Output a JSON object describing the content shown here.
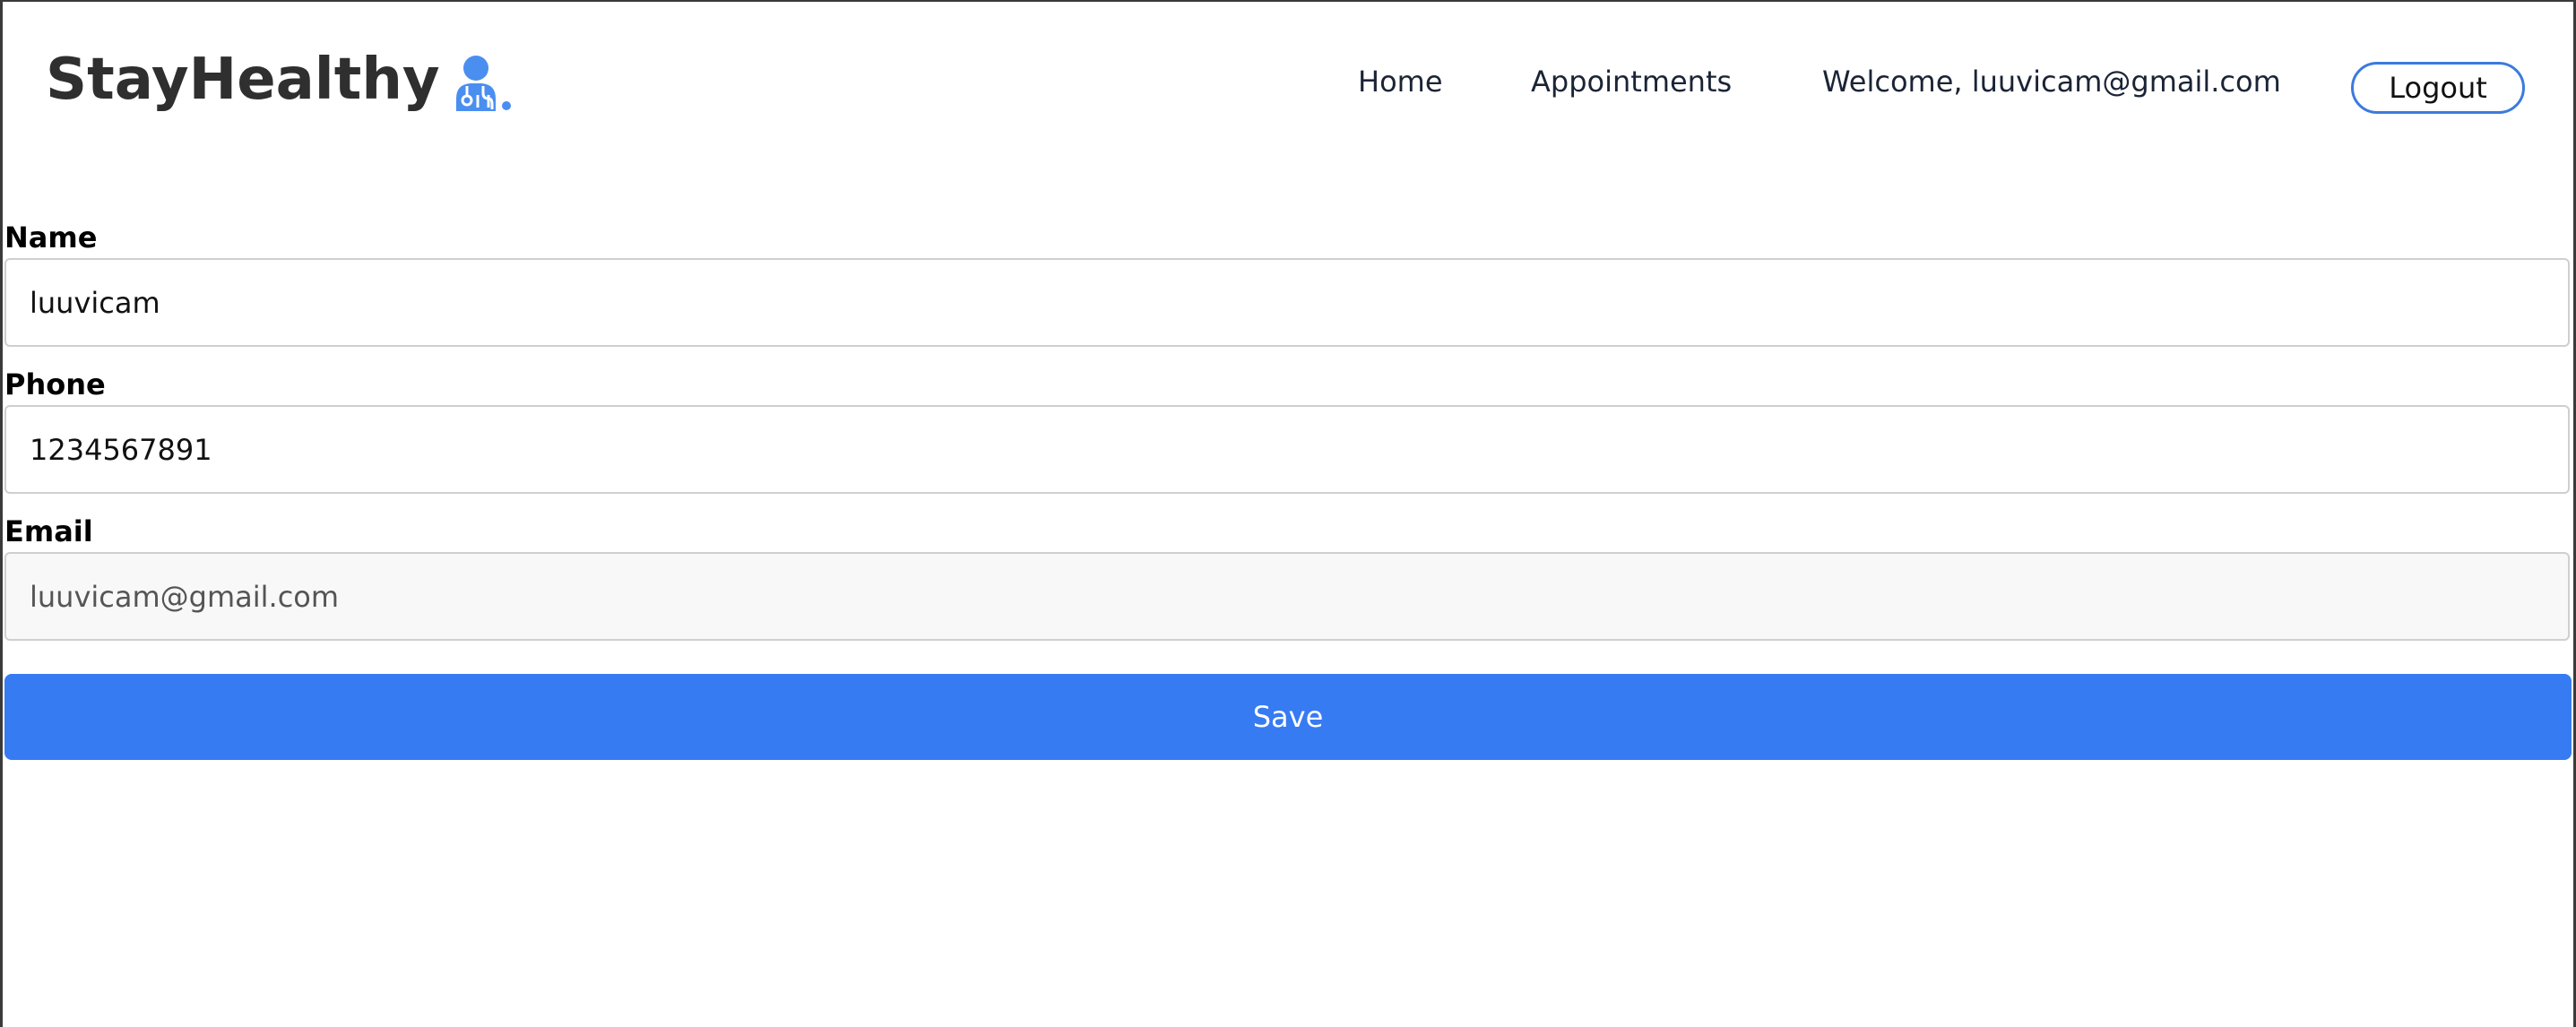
{
  "brand": {
    "name": "StayHealthy",
    "icon": "doctor-icon",
    "icon_color": "#4a8ef0"
  },
  "nav": {
    "home": "Home",
    "appointments": "Appointments",
    "welcome": "Welcome, luuvicam@gmail.com",
    "logout": "Logout"
  },
  "form": {
    "name_label": "Name",
    "name_value": "luuvicam",
    "phone_label": "Phone",
    "phone_value": "1234567891",
    "email_label": "Email",
    "email_value": "luuvicam@gmail.com",
    "save_label": "Save"
  },
  "colors": {
    "accent": "#377bf3",
    "logout_border": "#3b7bdc",
    "text_dark": "#2f2f2f",
    "readonly_bg": "#f8f8f8"
  }
}
